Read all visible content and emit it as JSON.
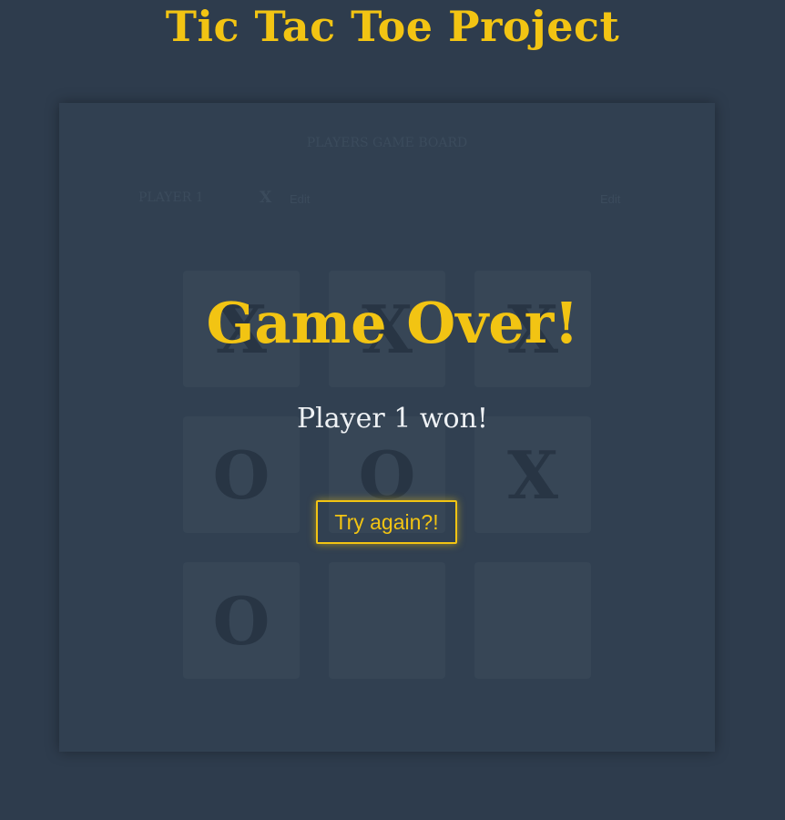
{
  "page": {
    "title": "Tic Tac Toe Project"
  },
  "board": {
    "heading": "PLAYERS GAME BOARD",
    "player1": {
      "name": "PLAYER 1",
      "symbol": "X",
      "edit_label": "Edit"
    },
    "player2": {
      "name": "",
      "symbol": "",
      "edit_label": "Edit"
    },
    "cells": [
      "X",
      "X",
      "X",
      "O",
      "O",
      "X",
      "O",
      "",
      ""
    ]
  },
  "game_over": {
    "title": "Game Over!",
    "message": "Player 1 won!",
    "button_label": "Try again?!"
  },
  "colors": {
    "background": "#2e3c4d",
    "accent": "#f2c413",
    "panel": "#314051",
    "cell": "#374656"
  }
}
